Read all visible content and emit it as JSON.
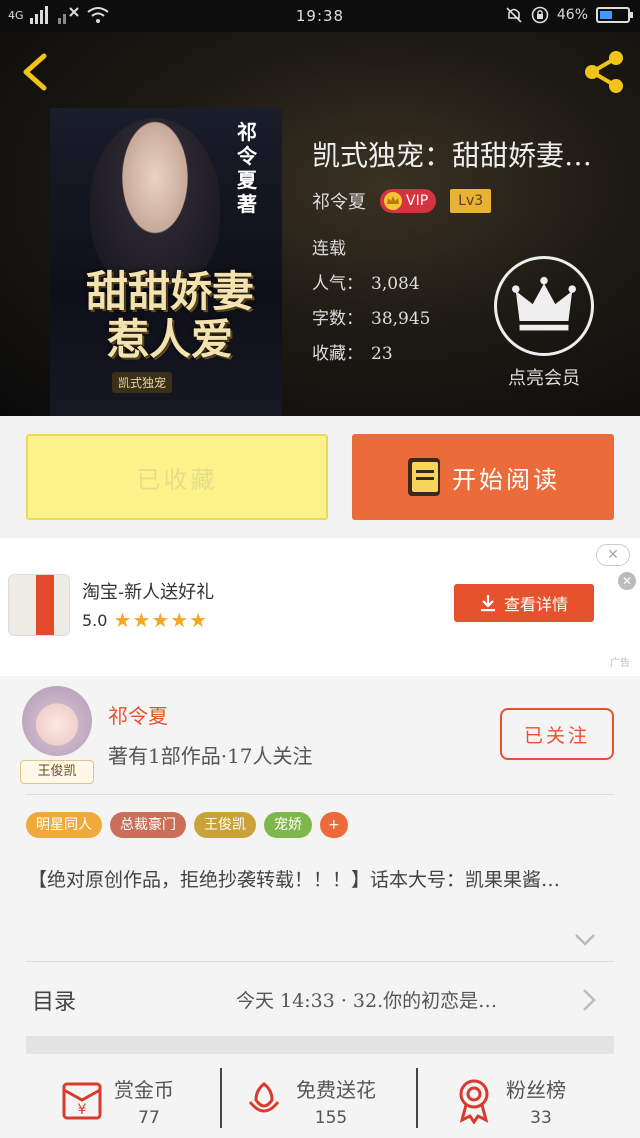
{
  "status_bar": {
    "signal": "4G",
    "time": "19:38",
    "battery": "46%",
    "battery_level": 0.46
  },
  "book": {
    "title": "凯式独宠：甜甜娇妻…",
    "author": "祁令夏",
    "vip": "VIP",
    "level": "Lv3",
    "status": "连载",
    "stats": [
      {
        "label": "人气：",
        "value": "3,084"
      },
      {
        "label": "字数：",
        "value": "38,945"
      },
      {
        "label": "收藏：",
        "value": "23"
      }
    ],
    "vip_cta": "点亮会员",
    "cover": {
      "author_vertical": "祁令夏著",
      "big_title": "甜甜娇妻惹人爱",
      "sub_title": "凯式独宠"
    }
  },
  "actions": {
    "collected": "已收藏",
    "start_reading": "开始阅读"
  },
  "ad": {
    "title": "淘宝-新人送好礼",
    "rating": "5.0",
    "stars": "★★★★★",
    "cta": "查看详情",
    "close": "✕",
    "tag": "广告"
  },
  "author": {
    "name": "祁令夏",
    "info": "著有1部作品·17人关注",
    "avatar_tag": "王俊凯",
    "follow": "已关注",
    "tags": [
      {
        "label": "明星同人",
        "color": "#f2a93b"
      },
      {
        "label": "总裁豪门",
        "color": "#c96f5a"
      },
      {
        "label": "王俊凯",
        "color": "#c9a23a"
      },
      {
        "label": "宠娇",
        "color": "#7fb84a"
      },
      {
        "label": "+",
        "color": "#ee6a3a"
      }
    ],
    "description": "【绝对原创作品，拒绝抄袭转载！！！】话本大号：凯果果酱…"
  },
  "toc": {
    "label": "目录",
    "latest": "今天 14:33 · 32.你的初恋是…"
  },
  "bottom_bar": [
    {
      "label": "赏金币",
      "count": "77"
    },
    {
      "label": "免费送花",
      "count": "155"
    },
    {
      "label": "粉丝榜",
      "count": "33"
    }
  ],
  "colors": {
    "accent": "#ec6b3b",
    "collected_bg": "#fdf28a",
    "hero_bg": "#1d1a14"
  }
}
